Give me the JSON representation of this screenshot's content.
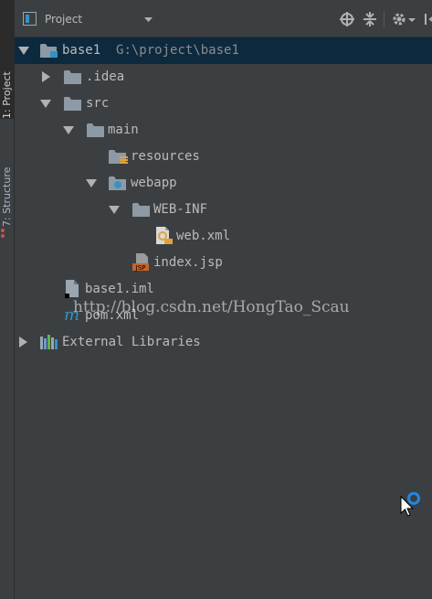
{
  "sidebar": {
    "tabs": [
      {
        "label": "1: Project"
      },
      {
        "label": "7: Structure"
      }
    ]
  },
  "header": {
    "title": "Project"
  },
  "tree": {
    "items": [
      {
        "label": "base1",
        "path": "G:\\project\\base1",
        "icon": "module-folder-icon",
        "expanded": true
      },
      {
        "label": ".idea",
        "icon": "folder-icon",
        "expanded": false
      },
      {
        "label": "src",
        "icon": "folder-icon",
        "expanded": true
      },
      {
        "label": "main",
        "icon": "folder-icon",
        "expanded": true
      },
      {
        "label": "resources",
        "icon": "resources-folder-icon"
      },
      {
        "label": "webapp",
        "icon": "web-folder-icon",
        "expanded": true
      },
      {
        "label": "WEB-INF",
        "icon": "folder-icon",
        "expanded": true
      },
      {
        "label": "web.xml",
        "icon": "web-xml-file-icon"
      },
      {
        "label": "index.jsp",
        "icon": "jsp-file-icon"
      },
      {
        "label": "base1.iml",
        "icon": "iml-file-icon"
      },
      {
        "label": "pom.xml",
        "icon": "maven-file-icon"
      },
      {
        "label": "External Libraries",
        "icon": "libraries-icon",
        "expanded": false
      }
    ]
  },
  "watermark": "http://blog.csdn.net/HongTao_Scau",
  "colors": {
    "background": "#3c3f41",
    "selection": "#0d293e",
    "text": "#bbbbbb",
    "path_text": "#8c8c8c",
    "folder": "#8d9aa5",
    "module_accent": "#3592c4"
  }
}
